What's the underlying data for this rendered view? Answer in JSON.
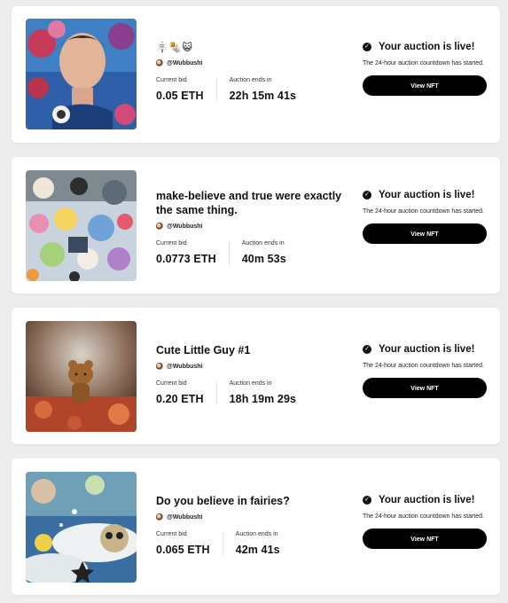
{
  "auctions": [
    {
      "title": "🪧🌯😺",
      "creator": "@Wubbushi",
      "current_bid_label": "Current bid",
      "current_bid": "0.05 ETH",
      "ends_label": "Auction ends in",
      "ends_in": "22h 15m 41s",
      "status_title": "Your auction is live!",
      "status_desc": "The 24-hour auction countdown has started.",
      "button_label": "View NFT"
    },
    {
      "title": "make-believe and true were exactly the same thing.",
      "creator": "@Wubbushi",
      "current_bid_label": "Current bid",
      "current_bid": "0.0773 ETH",
      "ends_label": "Auction ends in",
      "ends_in": "40m 53s",
      "status_title": "Your auction is live!",
      "status_desc": "The 24-hour auction countdown has started.",
      "button_label": "View NFT"
    },
    {
      "title": "Cute Little Guy #1",
      "creator": "@Wubbushi",
      "current_bid_label": "Current bid",
      "current_bid": "0.20 ETH",
      "ends_label": "Auction ends in",
      "ends_in": "18h 19m 29s",
      "status_title": "Your auction is live!",
      "status_desc": "The 24-hour auction countdown has started.",
      "button_label": "View NFT"
    },
    {
      "title": "Do you believe in fairies?",
      "creator": "@Wubbushi",
      "current_bid_label": "Current bid",
      "current_bid": "0.065 ETH",
      "ends_label": "Auction ends in",
      "ends_in": "42m 41s",
      "status_title": "Your auction is live!",
      "status_desc": "The 24-hour auction countdown has started.",
      "button_label": "View NFT"
    }
  ],
  "colors": {
    "page_bg": "#ededed",
    "card_bg": "#ffffff",
    "button_bg": "#000000",
    "button_text": "#ffffff"
  }
}
